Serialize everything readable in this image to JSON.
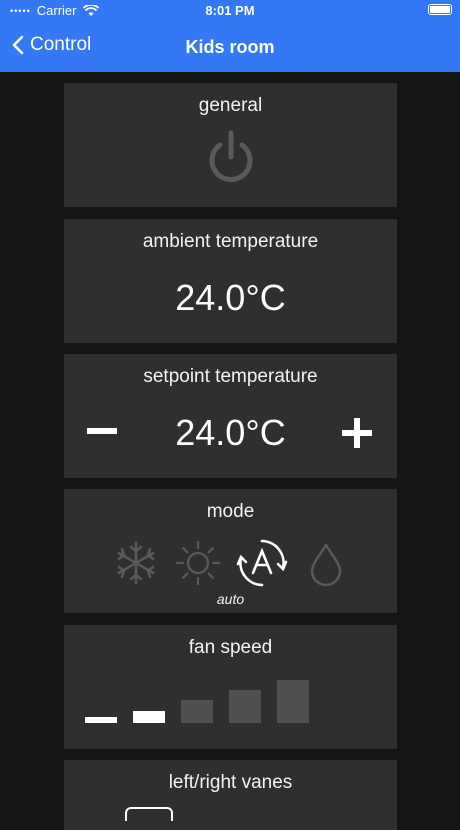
{
  "status_bar": {
    "carrier": "Carrier",
    "time": "8:01 PM"
  },
  "nav": {
    "back_label": "Control",
    "title": "Kids room"
  },
  "general": {
    "title": "general"
  },
  "ambient": {
    "title": "ambient temperature",
    "value": "24.0°C"
  },
  "setpoint": {
    "title": "setpoint temperature",
    "value": "24.0°C"
  },
  "mode": {
    "title": "mode",
    "options": [
      "cool",
      "heat",
      "auto",
      "dry"
    ],
    "selected": "auto",
    "selected_label": "auto"
  },
  "fan": {
    "title": "fan speed",
    "levels": 5,
    "selected_level": 2
  },
  "vanes": {
    "title": "left/right vanes"
  },
  "colors": {
    "accent": "#3478f6",
    "panel": "#2f2f2f",
    "background": "#151515",
    "inactive_icon": "#5a5a5a"
  }
}
